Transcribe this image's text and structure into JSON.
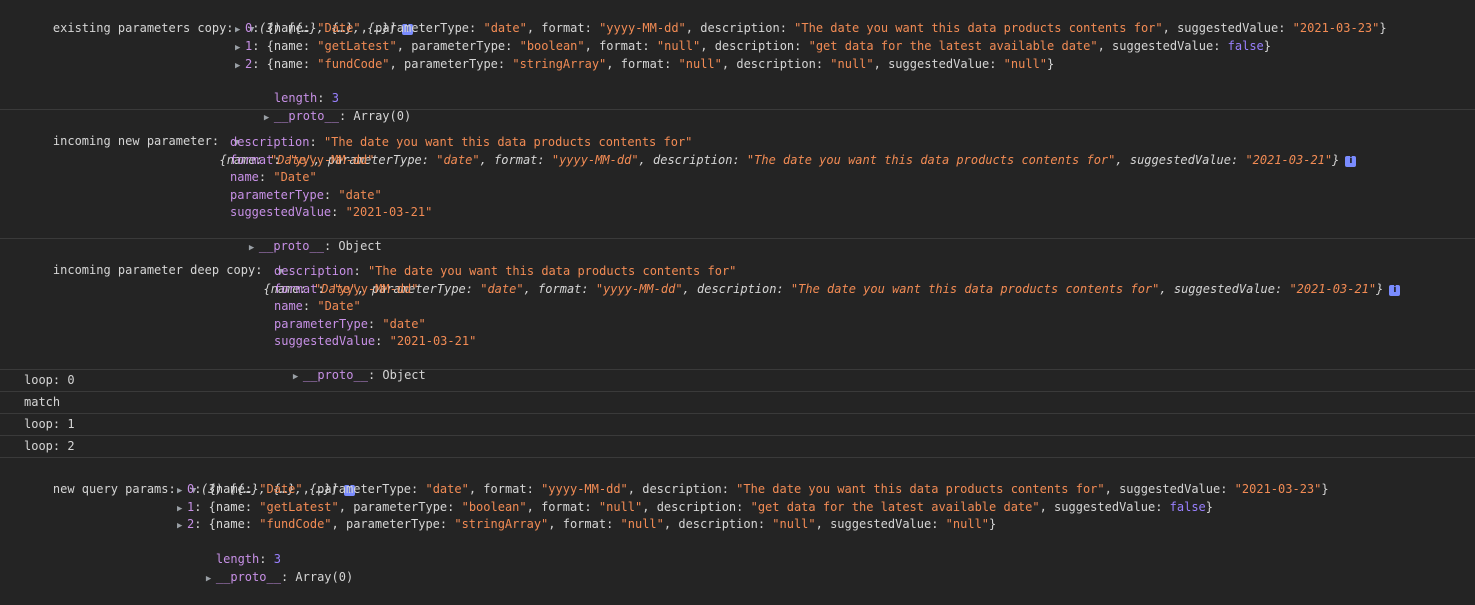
{
  "existing": {
    "label": "existing parameters copy:",
    "summary": "(3) [{…}, {…}, {…}]",
    "items": [
      {
        "idx": "0",
        "name": "\"Date\"",
        "parameterType": "\"date\"",
        "format": "\"yyyy-MM-dd\"",
        "description": "\"The date you want this data products contents for\"",
        "suggestedValue": "\"2021-03-23\""
      },
      {
        "idx": "1",
        "name": "\"getLatest\"",
        "parameterType": "\"boolean\"",
        "format": "\"null\"",
        "description": "\"get data for the latest available date\"",
        "suggestedValue": "false"
      },
      {
        "idx": "2",
        "name": "\"fundCode\"",
        "parameterType": "\"stringArray\"",
        "format": "\"null\"",
        "description": "\"null\"",
        "suggestedValue": "\"null\""
      }
    ],
    "length_key": "length",
    "length_value": "3",
    "proto_key": "__proto__",
    "proto_value": "Array(0)"
  },
  "incoming": {
    "label": "incoming new parameter:",
    "summary": {
      "name": "\"Date\"",
      "parameterType": "\"date\"",
      "format": "\"yyyy-MM-dd\"",
      "description": "\"The date you want this data products contents for\"",
      "suggestedValue": "\"2021-03-21\""
    },
    "props": [
      {
        "key": "description",
        "value": "\"The date you want this data products contents for\""
      },
      {
        "key": "format",
        "value": "\"yyyy-MM-dd\""
      },
      {
        "key": "name",
        "value": "\"Date\""
      },
      {
        "key": "parameterType",
        "value": "\"date\""
      },
      {
        "key": "suggestedValue",
        "value": "\"2021-03-21\""
      }
    ],
    "proto_key": "__proto__",
    "proto_value": "Object"
  },
  "deep": {
    "label": "incoming parameter deep copy:",
    "summary": {
      "name": "\"Date\"",
      "parameterType": "\"date\"",
      "format": "\"yyyy-MM-dd\"",
      "description": "\"The date you want this data products contents for\"",
      "suggestedValue": "\"2021-03-21\""
    },
    "props": [
      {
        "key": "description",
        "value": "\"The date you want this data products contents for\""
      },
      {
        "key": "format",
        "value": "\"yyyy-MM-dd\""
      },
      {
        "key": "name",
        "value": "\"Date\""
      },
      {
        "key": "parameterType",
        "value": "\"date\""
      },
      {
        "key": "suggestedValue",
        "value": "\"2021-03-21\""
      }
    ],
    "proto_key": "__proto__",
    "proto_value": "Object"
  },
  "simple_lines": [
    "loop: 0",
    "match",
    "loop: 1",
    "loop: 2"
  ],
  "newq": {
    "label": "new query params:",
    "summary": "(3) [{…}, {…}, {…}]",
    "items": [
      {
        "idx": "0",
        "name": "\"Date\"",
        "parameterType": "\"date\"",
        "format": "\"yyyy-MM-dd\"",
        "description": "\"The date you want this data products contents for\"",
        "suggestedValue": "\"2021-03-23\""
      },
      {
        "idx": "1",
        "name": "\"getLatest\"",
        "parameterType": "\"boolean\"",
        "format": "\"null\"",
        "description": "\"get data for the latest available date\"",
        "suggestedValue": "false"
      },
      {
        "idx": "2",
        "name": "\"fundCode\"",
        "parameterType": "\"stringArray\"",
        "format": "\"null\"",
        "description": "\"null\"",
        "suggestedValue": "\"null\""
      }
    ],
    "length_key": "length",
    "length_value": "3",
    "proto_key": "__proto__",
    "proto_value": "Array(0)"
  },
  "colors": {
    "background": "#242424",
    "key": "#c790e6",
    "string": "#f28b54",
    "boolean": "#9980ff",
    "text": "#d5d5d5"
  },
  "icons": {
    "expanded": "triangle-down-icon",
    "collapsed": "triangle-right-icon",
    "info": "info-icon"
  }
}
